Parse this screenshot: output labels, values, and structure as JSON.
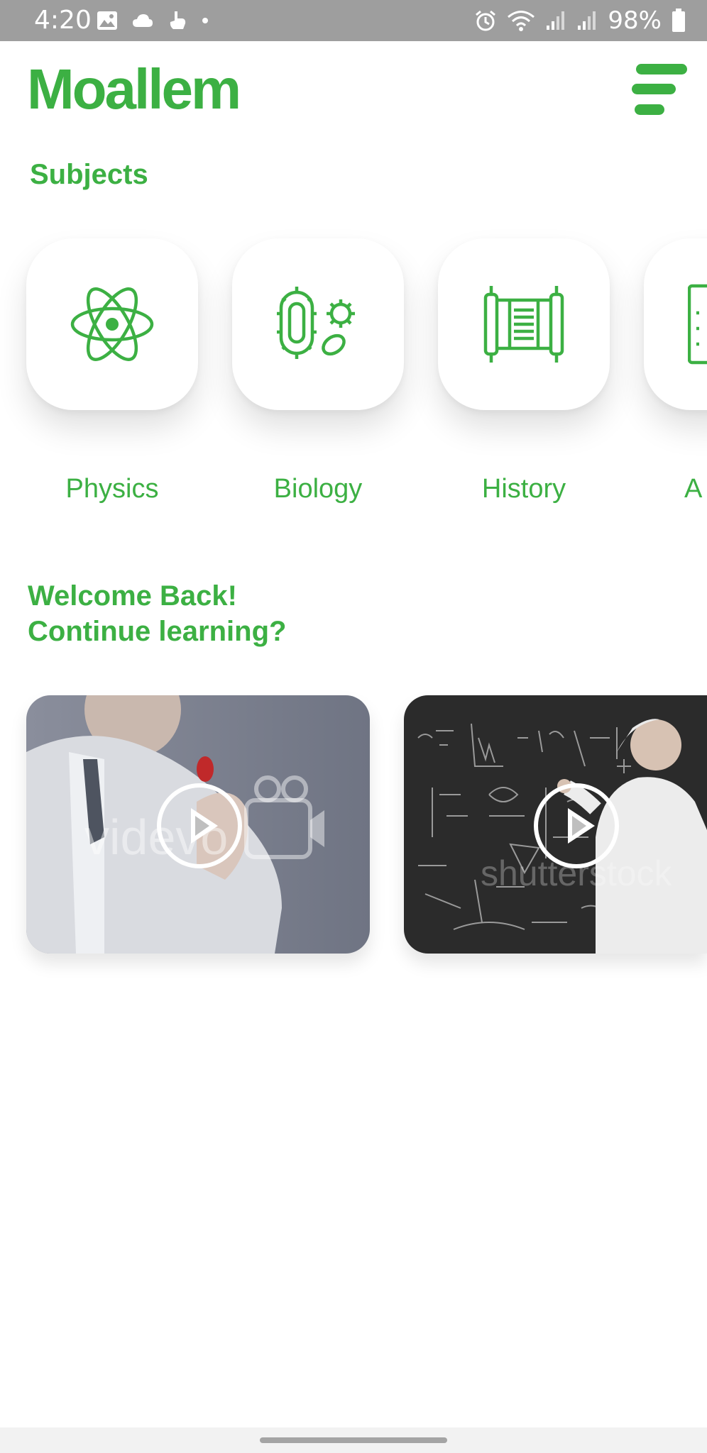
{
  "status_bar": {
    "time": "4:20",
    "battery": "98%"
  },
  "header": {
    "logo": "Moallem",
    "menu_icon": "hamburger-menu-icon"
  },
  "subjects": {
    "title": "Subjects",
    "items": [
      {
        "label": "Physics",
        "icon": "atom-icon"
      },
      {
        "label": "Biology",
        "icon": "cell-icon"
      },
      {
        "label": "History",
        "icon": "scroll-icon"
      },
      {
        "label": "A",
        "icon": "calculator-icon"
      }
    ]
  },
  "continue": {
    "line1": "Welcome Back!",
    "line2": "Continue learning?",
    "videos": [
      {
        "icon": "play-icon",
        "watermark": "videvo"
      },
      {
        "icon": "play-icon",
        "watermark": "shutterstock"
      }
    ]
  },
  "colors": {
    "accent": "#3cb043",
    "status_bar": "#9e9e9e"
  }
}
